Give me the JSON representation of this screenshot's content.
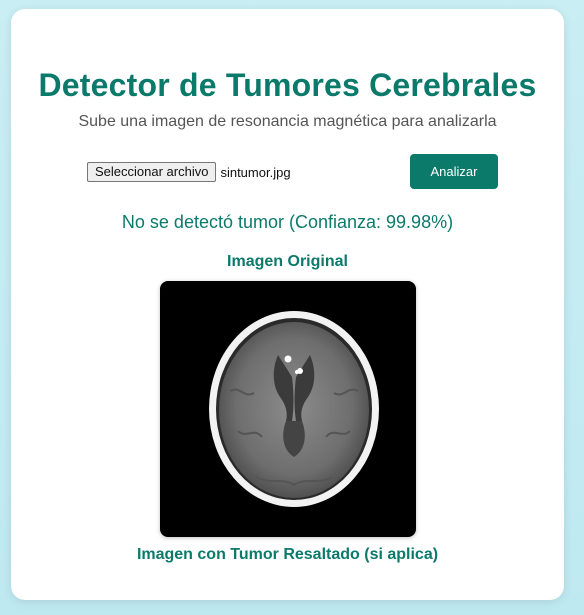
{
  "header": {
    "title": "Detector de Tumores Cerebrales",
    "subtitle": "Sube una imagen de resonancia magnética para analizarla"
  },
  "upload": {
    "button_label": "Seleccionar archivo",
    "file_name": "sintumor.jpg",
    "analyze_label": "Analizar"
  },
  "result": {
    "text": "No se detectó tumor (Confianza: 99.98%)"
  },
  "images": {
    "original_label": "Imagen Original",
    "highlight_label": "Imagen con Tumor Resaltado (si aplica)"
  },
  "colors": {
    "accent": "#0b7a6b",
    "background": "#c9eef4"
  }
}
